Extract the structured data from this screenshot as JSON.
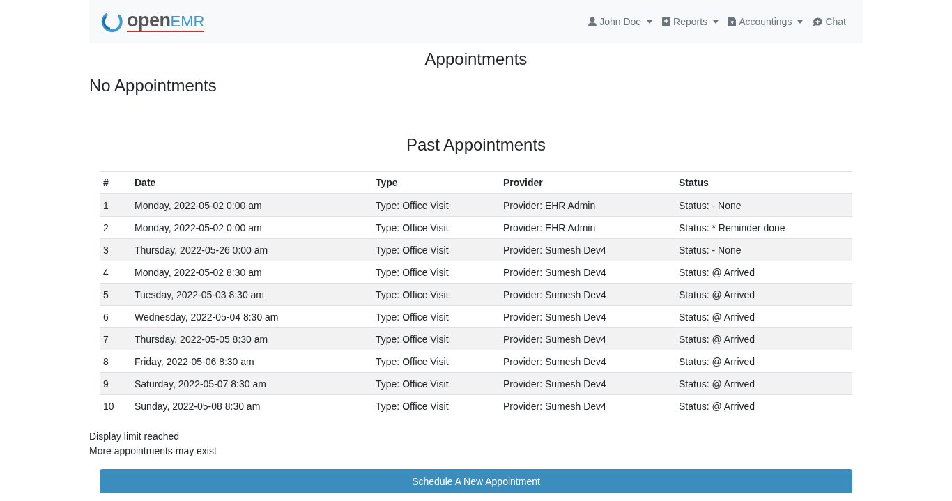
{
  "navbar": {
    "logo": {
      "part_1": "open",
      "part_2": "EMR"
    },
    "items": [
      {
        "label": "John Doe",
        "kind": "user",
        "dropdown": true
      },
      {
        "label": "Reports",
        "kind": "book",
        "dropdown": true
      },
      {
        "label": "Accountings",
        "kind": "invoice",
        "dropdown": true
      },
      {
        "label": "Chat",
        "kind": "chat",
        "dropdown": false
      }
    ]
  },
  "title": "Appointments",
  "upcoming": {
    "message": "No Appointments"
  },
  "past": {
    "title": "Past Appointments",
    "columns": [
      "#",
      "Date",
      "Type",
      "Provider",
      "Status"
    ],
    "rows": [
      [
        "1",
        "Monday, 2022-05-02 0:00 am",
        "Type: Office Visit",
        "Provider: EHR Admin",
        "Status: - None"
      ],
      [
        "2",
        "Monday, 2022-05-02 0:00 am",
        "Type: Office Visit",
        "Provider: EHR Admin",
        "Status: * Reminder done"
      ],
      [
        "3",
        "Thursday, 2022-05-26 0:00 am",
        "Type: Office Visit",
        "Provider: Sumesh Dev4",
        "Status: - None"
      ],
      [
        "4",
        "Monday, 2022-05-02 8:30 am",
        "Type: Office Visit",
        "Provider: Sumesh Dev4",
        "Status: @ Arrived"
      ],
      [
        "5",
        "Tuesday, 2022-05-03 8:30 am",
        "Type: Office Visit",
        "Provider: Sumesh Dev4",
        "Status: @ Arrived"
      ],
      [
        "6",
        "Wednesday, 2022-05-04 8:30 am",
        "Type: Office Visit",
        "Provider: Sumesh Dev4",
        "Status: @ Arrived"
      ],
      [
        "7",
        "Thursday, 2022-05-05 8:30 am",
        "Type: Office Visit",
        "Provider: Sumesh Dev4",
        "Status: @ Arrived"
      ],
      [
        "8",
        "Friday, 2022-05-06 8:30 am",
        "Type: Office Visit",
        "Provider: Sumesh Dev4",
        "Status: @ Arrived"
      ],
      [
        "9",
        "Saturday, 2022-05-07 8:30 am",
        "Type: Office Visit",
        "Provider: Sumesh Dev4",
        "Status: @ Arrived"
      ],
      [
        "10",
        "Sunday, 2022-05-08 8:30 am",
        "Type: Office Visit",
        "Provider: Sumesh Dev4",
        "Status: @ Arrived"
      ]
    ],
    "notes": [
      "Display limit reached",
      "More appointments may exist"
    ]
  },
  "button": "Schedule A New Appointment"
}
